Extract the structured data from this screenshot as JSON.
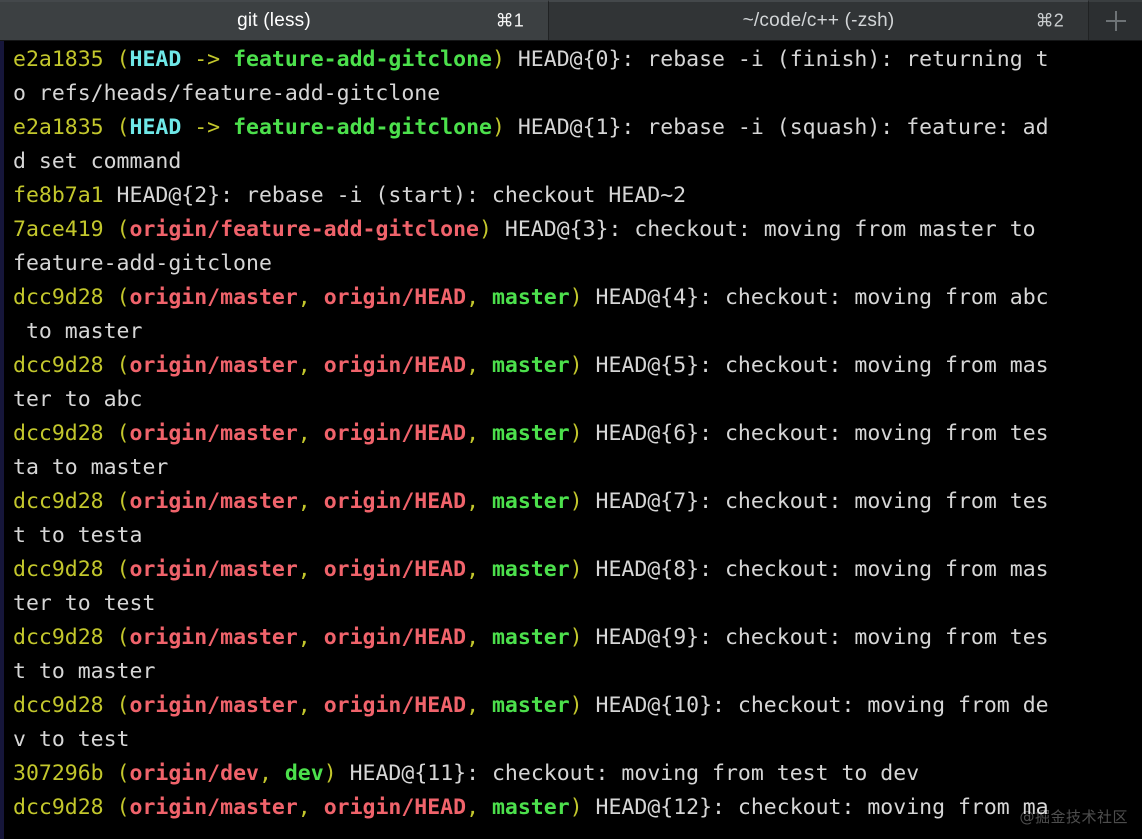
{
  "window": {
    "app": "terminal",
    "theme_background": "#000000",
    "tabbar_background": "#2f3133"
  },
  "tabbar": {
    "tabs": [
      {
        "title": "git (less)",
        "shortcut": "⌘1",
        "active": true
      },
      {
        "title": "~/code/c++ (-zsh)",
        "shortcut": "⌘2",
        "active": false
      }
    ],
    "new_tab_icon": "plus-icon"
  },
  "colors": {
    "hash": "#c3c72c",
    "paren": "#c3c72c",
    "head": "#6fe8e8",
    "local_branch": "#4ce04c",
    "remote_branch": "#f0636b",
    "text": "#d6d6d6",
    "background": "#000000"
  },
  "terminal": {
    "program": "git (less)",
    "lines": [
      [
        {
          "t": "e2a1835",
          "c": "hash"
        },
        {
          "t": " ",
          "c": "plain"
        },
        {
          "t": "(",
          "c": "paren"
        },
        {
          "t": "HEAD",
          "c": "head"
        },
        {
          "t": " -> ",
          "c": "paren"
        },
        {
          "t": "feature-add-gitclone",
          "c": "local"
        },
        {
          "t": ")",
          "c": "paren"
        },
        {
          "t": " HEAD@{0}: rebase -i (finish): returning t",
          "c": "plain"
        }
      ],
      [
        {
          "t": "o refs/heads/feature-add-gitclone",
          "c": "plain"
        }
      ],
      [
        {
          "t": "e2a1835",
          "c": "hash"
        },
        {
          "t": " ",
          "c": "plain"
        },
        {
          "t": "(",
          "c": "paren"
        },
        {
          "t": "HEAD",
          "c": "head"
        },
        {
          "t": " -> ",
          "c": "paren"
        },
        {
          "t": "feature-add-gitclone",
          "c": "local"
        },
        {
          "t": ")",
          "c": "paren"
        },
        {
          "t": " HEAD@{1}: rebase -i (squash): feature: ad",
          "c": "plain"
        }
      ],
      [
        {
          "t": "d set command",
          "c": "plain"
        }
      ],
      [
        {
          "t": "fe8b7a1",
          "c": "hash"
        },
        {
          "t": " HEAD@{2}: rebase -i (start): checkout HEAD~2",
          "c": "plain"
        }
      ],
      [
        {
          "t": "7ace419",
          "c": "hash"
        },
        {
          "t": " ",
          "c": "plain"
        },
        {
          "t": "(",
          "c": "paren"
        },
        {
          "t": "origin/feature-add-gitclone",
          "c": "remote"
        },
        {
          "t": ")",
          "c": "paren"
        },
        {
          "t": " HEAD@{3}: checkout: moving from master to",
          "c": "plain"
        }
      ],
      [
        {
          "t": "feature-add-gitclone",
          "c": "plain"
        }
      ],
      [
        {
          "t": "dcc9d28",
          "c": "hash"
        },
        {
          "t": " ",
          "c": "plain"
        },
        {
          "t": "(",
          "c": "paren"
        },
        {
          "t": "origin/master",
          "c": "remote"
        },
        {
          "t": ", ",
          "c": "paren"
        },
        {
          "t": "origin/HEAD",
          "c": "remote"
        },
        {
          "t": ", ",
          "c": "paren"
        },
        {
          "t": "master",
          "c": "local"
        },
        {
          "t": ")",
          "c": "paren"
        },
        {
          "t": " HEAD@{4}: checkout: moving from abc",
          "c": "plain"
        }
      ],
      [
        {
          "t": " to master",
          "c": "plain"
        }
      ],
      [
        {
          "t": "dcc9d28",
          "c": "hash"
        },
        {
          "t": " ",
          "c": "plain"
        },
        {
          "t": "(",
          "c": "paren"
        },
        {
          "t": "origin/master",
          "c": "remote"
        },
        {
          "t": ", ",
          "c": "paren"
        },
        {
          "t": "origin/HEAD",
          "c": "remote"
        },
        {
          "t": ", ",
          "c": "paren"
        },
        {
          "t": "master",
          "c": "local"
        },
        {
          "t": ")",
          "c": "paren"
        },
        {
          "t": " HEAD@{5}: checkout: moving from mas",
          "c": "plain"
        }
      ],
      [
        {
          "t": "ter to abc",
          "c": "plain"
        }
      ],
      [
        {
          "t": "dcc9d28",
          "c": "hash"
        },
        {
          "t": " ",
          "c": "plain"
        },
        {
          "t": "(",
          "c": "paren"
        },
        {
          "t": "origin/master",
          "c": "remote"
        },
        {
          "t": ", ",
          "c": "paren"
        },
        {
          "t": "origin/HEAD",
          "c": "remote"
        },
        {
          "t": ", ",
          "c": "paren"
        },
        {
          "t": "master",
          "c": "local"
        },
        {
          "t": ")",
          "c": "paren"
        },
        {
          "t": " HEAD@{6}: checkout: moving from tes",
          "c": "plain"
        }
      ],
      [
        {
          "t": "ta to master",
          "c": "plain"
        }
      ],
      [
        {
          "t": "dcc9d28",
          "c": "hash"
        },
        {
          "t": " ",
          "c": "plain"
        },
        {
          "t": "(",
          "c": "paren"
        },
        {
          "t": "origin/master",
          "c": "remote"
        },
        {
          "t": ", ",
          "c": "paren"
        },
        {
          "t": "origin/HEAD",
          "c": "remote"
        },
        {
          "t": ", ",
          "c": "paren"
        },
        {
          "t": "master",
          "c": "local"
        },
        {
          "t": ")",
          "c": "paren"
        },
        {
          "t": " HEAD@{7}: checkout: moving from tes",
          "c": "plain"
        }
      ],
      [
        {
          "t": "t to testa",
          "c": "plain"
        }
      ],
      [
        {
          "t": "dcc9d28",
          "c": "hash"
        },
        {
          "t": " ",
          "c": "plain"
        },
        {
          "t": "(",
          "c": "paren"
        },
        {
          "t": "origin/master",
          "c": "remote"
        },
        {
          "t": ", ",
          "c": "paren"
        },
        {
          "t": "origin/HEAD",
          "c": "remote"
        },
        {
          "t": ", ",
          "c": "paren"
        },
        {
          "t": "master",
          "c": "local"
        },
        {
          "t": ")",
          "c": "paren"
        },
        {
          "t": " HEAD@{8}: checkout: moving from mas",
          "c": "plain"
        }
      ],
      [
        {
          "t": "ter to test",
          "c": "plain"
        }
      ],
      [
        {
          "t": "dcc9d28",
          "c": "hash"
        },
        {
          "t": " ",
          "c": "plain"
        },
        {
          "t": "(",
          "c": "paren"
        },
        {
          "t": "origin/master",
          "c": "remote"
        },
        {
          "t": ", ",
          "c": "paren"
        },
        {
          "t": "origin/HEAD",
          "c": "remote"
        },
        {
          "t": ", ",
          "c": "paren"
        },
        {
          "t": "master",
          "c": "local"
        },
        {
          "t": ")",
          "c": "paren"
        },
        {
          "t": " HEAD@{9}: checkout: moving from tes",
          "c": "plain"
        }
      ],
      [
        {
          "t": "t to master",
          "c": "plain"
        }
      ],
      [
        {
          "t": "dcc9d28",
          "c": "hash"
        },
        {
          "t": " ",
          "c": "plain"
        },
        {
          "t": "(",
          "c": "paren"
        },
        {
          "t": "origin/master",
          "c": "remote"
        },
        {
          "t": ", ",
          "c": "paren"
        },
        {
          "t": "origin/HEAD",
          "c": "remote"
        },
        {
          "t": ", ",
          "c": "paren"
        },
        {
          "t": "master",
          "c": "local"
        },
        {
          "t": ")",
          "c": "paren"
        },
        {
          "t": " HEAD@{10}: checkout: moving from de",
          "c": "plain"
        }
      ],
      [
        {
          "t": "v to test",
          "c": "plain"
        }
      ],
      [
        {
          "t": "307296b",
          "c": "hash"
        },
        {
          "t": " ",
          "c": "plain"
        },
        {
          "t": "(",
          "c": "paren"
        },
        {
          "t": "origin/dev",
          "c": "remote"
        },
        {
          "t": ", ",
          "c": "paren"
        },
        {
          "t": "dev",
          "c": "local"
        },
        {
          "t": ")",
          "c": "paren"
        },
        {
          "t": " HEAD@{11}: checkout: moving from test to dev",
          "c": "plain"
        }
      ],
      [
        {
          "t": "dcc9d28",
          "c": "hash"
        },
        {
          "t": " ",
          "c": "plain"
        },
        {
          "t": "(",
          "c": "paren"
        },
        {
          "t": "origin/master",
          "c": "remote"
        },
        {
          "t": ", ",
          "c": "paren"
        },
        {
          "t": "origin/HEAD",
          "c": "remote"
        },
        {
          "t": ", ",
          "c": "paren"
        },
        {
          "t": "master",
          "c": "local"
        },
        {
          "t": ")",
          "c": "paren"
        },
        {
          "t": " HEAD@{12}: checkout: moving from ma",
          "c": "plain"
        }
      ]
    ]
  },
  "watermark": {
    "text": "@掘金技术社区"
  }
}
